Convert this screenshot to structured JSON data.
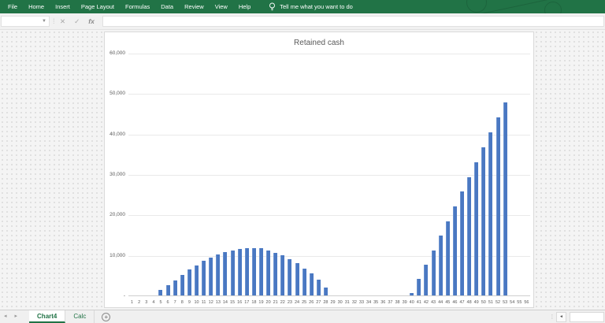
{
  "ribbon": {
    "background": "#217346",
    "tabs": [
      "File",
      "Home",
      "Insert",
      "Page Layout",
      "Formulas",
      "Data",
      "Review",
      "View",
      "Help"
    ],
    "tell_me_label": "Tell me what you want to do"
  },
  "formula_bar": {
    "name_box_value": "",
    "cancel_icon": "✕",
    "enter_icon": "✓",
    "fx_label": "fx",
    "formula_value": ""
  },
  "chart_data": {
    "type": "bar",
    "title": "Retained cash",
    "categories": [
      "1",
      "2",
      "3",
      "4",
      "5",
      "6",
      "7",
      "8",
      "9",
      "10",
      "11",
      "12",
      "13",
      "14",
      "15",
      "16",
      "17",
      "18",
      "19",
      "20",
      "21",
      "22",
      "23",
      "24",
      "25",
      "26",
      "27",
      "28",
      "29",
      "30",
      "31",
      "32",
      "33",
      "34",
      "35",
      "36",
      "37",
      "38",
      "39",
      "40",
      "41",
      "42",
      "43",
      "44",
      "45",
      "46",
      "47",
      "48",
      "49",
      "50",
      "51",
      "52",
      "53",
      "54",
      "55",
      "56"
    ],
    "values": [
      0,
      0,
      0,
      0,
      1400,
      2600,
      3800,
      5100,
      6400,
      7500,
      8500,
      9400,
      10100,
      10800,
      11200,
      11500,
      11700,
      11700,
      11600,
      11200,
      10600,
      9900,
      9000,
      7900,
      6700,
      5400,
      3900,
      2000,
      0,
      0,
      0,
      0,
      0,
      0,
      0,
      0,
      0,
      0,
      0,
      500,
      4000,
      7600,
      11200,
      14800,
      18400,
      22100,
      25700,
      29300,
      33000,
      36700,
      40400,
      44000,
      47700,
      0,
      0,
      0
    ],
    "ylim": [
      0,
      60000
    ],
    "ytick_interval": 10000,
    "ytick_labels_bottom_to_top": [
      "-",
      "10,000",
      "20,000",
      "30,000",
      "40,000",
      "50,000",
      "60,000"
    ],
    "grid": true,
    "legend": "none",
    "bar_color": "#4a78c2"
  },
  "sheet_bar": {
    "nav_prev": "◂",
    "nav_next": "▸",
    "tabs": [
      {
        "label": "Chart4",
        "active": true
      },
      {
        "label": "Calc",
        "active": false
      }
    ],
    "add_sheet_label": "+",
    "divider": "⁞",
    "scroll_left_icon": "◄"
  }
}
